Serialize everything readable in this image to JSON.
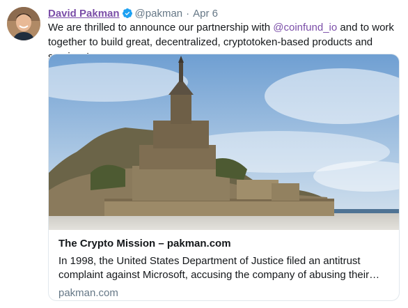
{
  "tweet": {
    "author_name": "David Pakman",
    "handle": "@pakman",
    "separator": "·",
    "time": "Apr 6",
    "text_before": "We are thrilled to announce our partnership with ",
    "mention": "@coinfund_io",
    "text_after": " and to work together to build great, decentralized, cryptotoken-based products and services!"
  },
  "card": {
    "title": "The Crypto Mission – pakman.com",
    "description": "In 1998, the United States Department of Justice filed an antitrust complaint against Microsoft, accusing the company of abusing their…",
    "domain": "pakman.com"
  },
  "colors": {
    "name_link": "#7b4ea8",
    "verified": "#1da1f2",
    "secondary_text": "#657786",
    "card_border": "#e1e8ed"
  },
  "icons": {
    "verified": "verified-badge-icon"
  }
}
